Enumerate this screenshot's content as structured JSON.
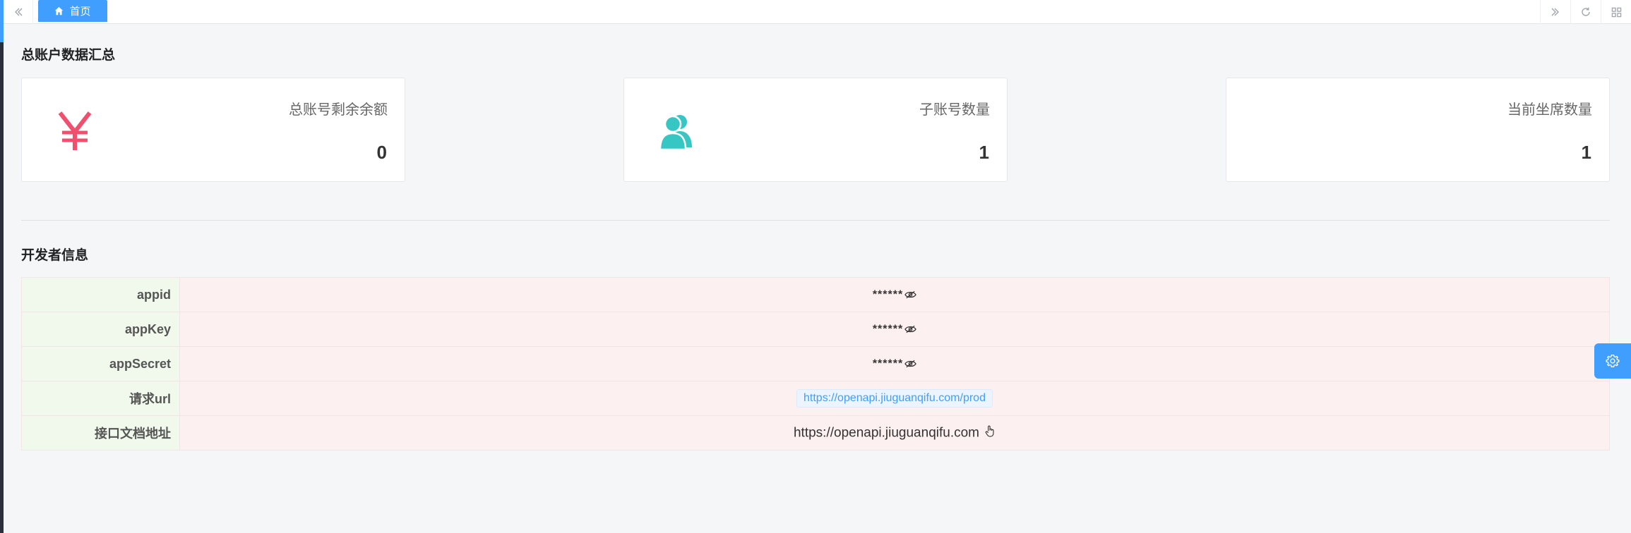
{
  "tabs": {
    "active_label": "首页"
  },
  "overview": {
    "title": "总账户数据汇总",
    "cards": [
      {
        "label": "总账号剩余余额",
        "value": "0",
        "icon": "yen-icon",
        "color": "#f0506e"
      },
      {
        "label": "子账号数量",
        "value": "1",
        "icon": "users-icon",
        "color": "#36c6c4"
      },
      {
        "label": "当前坐席数量",
        "value": "1",
        "icon": "",
        "color": ""
      }
    ]
  },
  "developer": {
    "title": "开发者信息",
    "rows": [
      {
        "key": "appid",
        "value": "******"
      },
      {
        "key": "appKey",
        "value": "******"
      },
      {
        "key": "appSecret",
        "value": "******"
      },
      {
        "key": "请求url",
        "value": "https://openapi.jiuguanqifu.com/prod"
      },
      {
        "key": "接口文档地址",
        "value": "https://openapi.jiuguanqifu.com"
      }
    ]
  },
  "colors": {
    "accent": "#409eff",
    "key_cell_bg": "#f0f9eb",
    "value_cell_bg": "#fdf0f0"
  }
}
